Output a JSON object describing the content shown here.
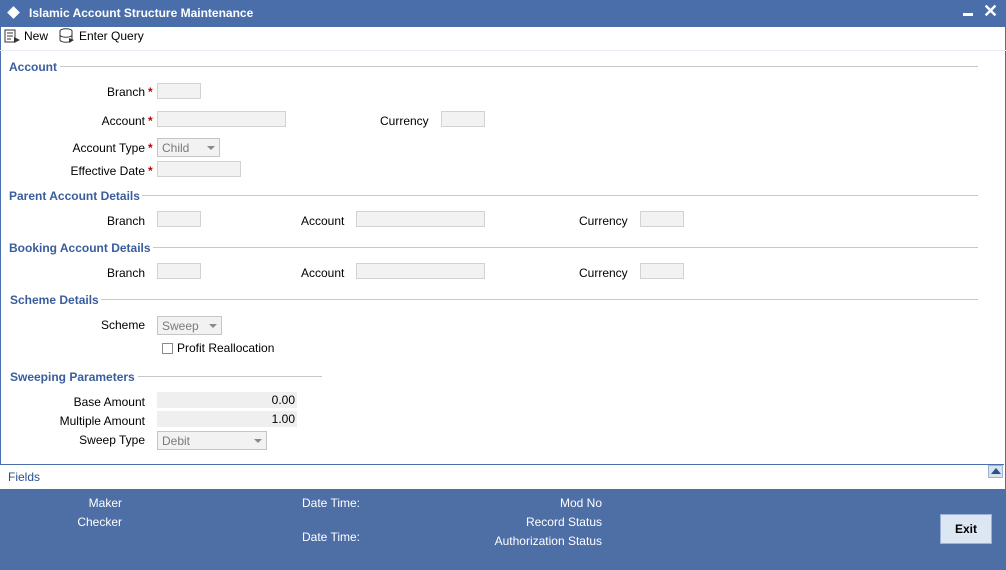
{
  "window": {
    "title": "Islamic Account Structure Maintenance",
    "minimize_icon": "minimize-icon",
    "close_icon": "close-icon"
  },
  "toolbar": {
    "new_label": "New",
    "enter_query_label": "Enter Query"
  },
  "account": {
    "section_title": "Account",
    "branch_label": "Branch",
    "account_label": "Account",
    "currency_label": "Currency",
    "account_type_label": "Account Type",
    "account_type_value": "Child",
    "effective_date_label": "Effective Date",
    "required_mark": "*"
  },
  "parent_account": {
    "section_title": "Parent Account Details",
    "branch_label": "Branch",
    "account_label": "Account",
    "currency_label": "Currency"
  },
  "booking_account": {
    "section_title": "Booking Account Details",
    "branch_label": "Branch",
    "account_label": "Account",
    "currency_label": "Currency"
  },
  "scheme": {
    "section_title": "Scheme Details",
    "scheme_label": "Scheme",
    "scheme_value": "Sweep",
    "profit_reallocation_label": "Profit Reallocation",
    "profit_reallocation_checked": false
  },
  "sweeping": {
    "section_title": "Sweeping Parameters",
    "base_amount_label": "Base Amount",
    "base_amount_value": "0.00",
    "multiple_amount_label": "Multiple Amount",
    "multiple_amount_value": "1.00",
    "sweep_type_label": "Sweep Type",
    "sweep_type_value": "Debit"
  },
  "fields_bar": {
    "label": "Fields"
  },
  "audit": {
    "maker_label": "Maker",
    "checker_label": "Checker",
    "date_time_label_1": "Date Time:",
    "date_time_label_2": "Date Time:",
    "mod_no_label": "Mod No",
    "record_status_label": "Record Status",
    "authorization_status_label": "Authorization Status",
    "exit_label": "Exit"
  },
  "colors": {
    "title_bar": "#4a6ea9",
    "section_title": "#3a5d9c",
    "audit_bar": "#4e6ea6",
    "required": "#c00000"
  }
}
